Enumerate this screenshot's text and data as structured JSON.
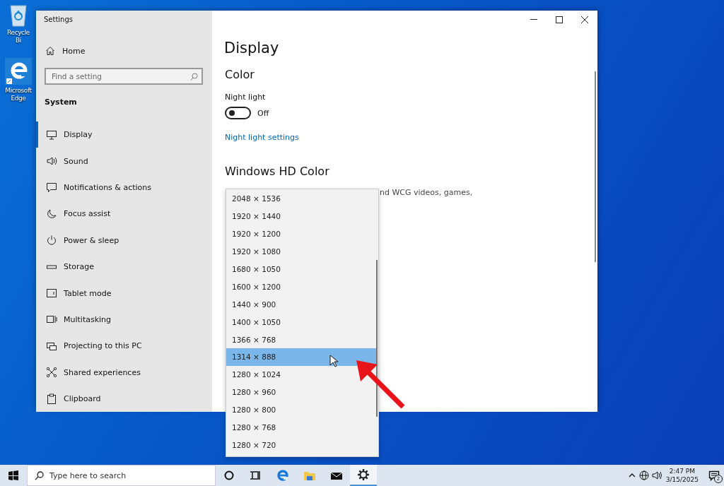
{
  "desktop_icons": [
    {
      "kind": "recycle-bin",
      "label": "Recycle Bi"
    },
    {
      "kind": "edge",
      "label": "Microsoft Edge"
    }
  ],
  "window": {
    "title": "Settings",
    "sidebar": {
      "home": "Home",
      "search": {
        "placeholder": "Find a setting"
      },
      "section": "System",
      "items": [
        {
          "label": "Display",
          "selected": true
        },
        {
          "label": "Sound",
          "selected": false
        },
        {
          "label": "Notifications & actions",
          "selected": false
        },
        {
          "label": "Focus assist",
          "selected": false
        },
        {
          "label": "Power & sleep",
          "selected": false
        },
        {
          "label": "Storage",
          "selected": false
        },
        {
          "label": "Tablet mode",
          "selected": false
        },
        {
          "label": "Multitasking",
          "selected": false
        },
        {
          "label": "Projecting to this PC",
          "selected": false
        },
        {
          "label": "Shared experiences",
          "selected": false
        },
        {
          "label": "Clipboard",
          "selected": false
        }
      ]
    },
    "content": {
      "title": "Display",
      "color_heading": "Color",
      "night_light": {
        "label": "Night light",
        "on": false,
        "state_text": "Off"
      },
      "night_light_link": "Night light settings",
      "hd_heading": "Windows HD Color",
      "hd_description": "nd WCG videos, games,"
    }
  },
  "dropdown": {
    "items": [
      {
        "label": "2048 × 1536",
        "selected": false
      },
      {
        "label": "1920 × 1440",
        "selected": false
      },
      {
        "label": "1920 × 1200",
        "selected": false
      },
      {
        "label": "1920 × 1080",
        "selected": false
      },
      {
        "label": "1680 × 1050",
        "selected": false
      },
      {
        "label": "1600 × 1200",
        "selected": false
      },
      {
        "label": "1440 × 900",
        "selected": false
      },
      {
        "label": "1400 × 1050",
        "selected": false
      },
      {
        "label": "1366 × 768",
        "selected": false
      },
      {
        "label": "1314 × 888",
        "selected": true
      },
      {
        "label": "1280 × 1024",
        "selected": false
      },
      {
        "label": "1280 × 960",
        "selected": false
      },
      {
        "label": "1280 × 800",
        "selected": false
      },
      {
        "label": "1280 × 768",
        "selected": false
      },
      {
        "label": "1280 × 720",
        "selected": false
      }
    ]
  },
  "taskbar": {
    "search_placeholder": "Type here to search",
    "apps": [
      {
        "kind": "cortana",
        "active": false
      },
      {
        "kind": "task-view",
        "active": false
      },
      {
        "kind": "edge",
        "active": false
      },
      {
        "kind": "explorer",
        "active": false
      },
      {
        "kind": "mail",
        "active": false
      },
      {
        "kind": "settings",
        "active": true
      }
    ],
    "time": "2:47 PM",
    "date": "3/15/2025",
    "notification_count": "2"
  }
}
